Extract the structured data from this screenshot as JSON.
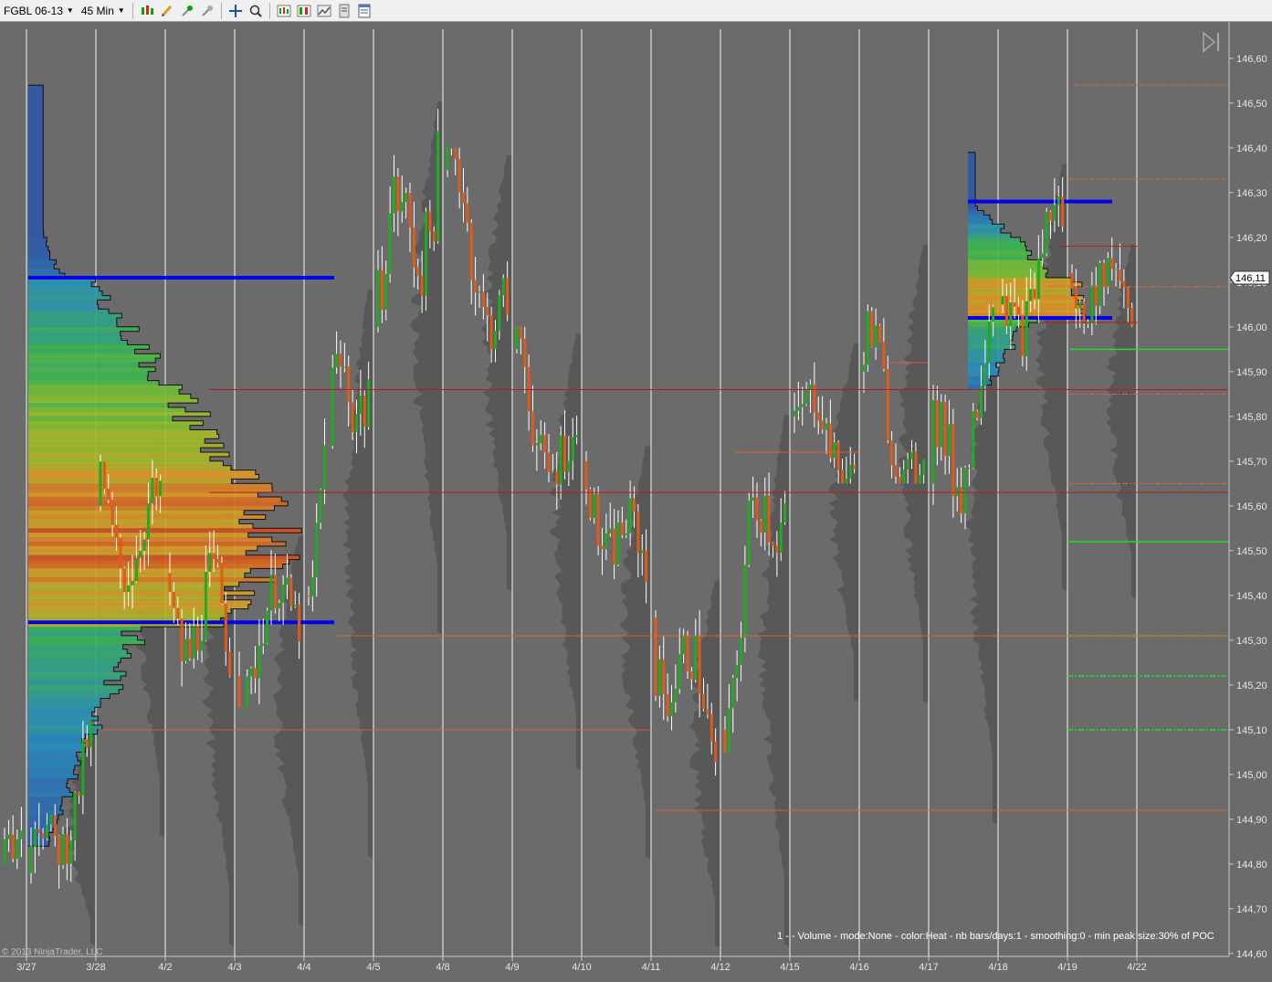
{
  "toolbar": {
    "instrument": "FGBL 06-13",
    "interval": "45 Min",
    "icons": [
      "bar-type-icon",
      "drawing-tools-icon",
      "pin-icon",
      "pin-global-icon",
      "crosshair-icon",
      "zoom-icon",
      "indicators-icon",
      "strategies-icon",
      "chart-properties-icon",
      "data-box-icon",
      "properties-icon"
    ]
  },
  "chart_data": {
    "type": "candlestick-volume-profile",
    "instrument": "FGBL 06-13",
    "interval": "45 Min",
    "ylim": [
      144.555,
      146.665
    ],
    "price_ticks": [
      "146,60",
      "146,50",
      "146,40",
      "146,30",
      "146,20",
      "146,10",
      "146,00",
      "145,90",
      "145,80",
      "145,70",
      "145,60",
      "145,50",
      "145,40",
      "145,30",
      "145,20",
      "145,10",
      "145,00",
      "144,90",
      "144,80",
      "144,70",
      "144,60"
    ],
    "price_values": [
      146.6,
      146.5,
      146.4,
      146.3,
      146.2,
      146.1,
      146.0,
      145.9,
      145.8,
      145.7,
      145.6,
      145.5,
      145.4,
      145.3,
      145.2,
      145.1,
      145.0,
      144.9,
      144.8,
      144.7,
      144.6
    ],
    "dates": [
      "3/27",
      "3/28",
      "4/2",
      "4/3",
      "4/4",
      "4/5",
      "4/8",
      "4/9",
      "4/10",
      "4/11",
      "4/12",
      "4/15",
      "4/16",
      "4/17",
      "4/18",
      "4/19",
      "4/22"
    ],
    "session_sides": [
      {
        "open": 144.78,
        "close": 145.04,
        "high": 145.12,
        "low": 144.7
      },
      {
        "open": 145.6,
        "close": 145.5,
        "high": 145.85,
        "low": 145.35
      },
      {
        "open": 145.45,
        "close": 145.25,
        "high": 145.7,
        "low": 145.1
      },
      {
        "open": 145.22,
        "close": 145.4,
        "high": 145.55,
        "low": 145.15
      },
      {
        "open": 145.4,
        "close": 146.05,
        "high": 146.1,
        "low": 145.3
      },
      {
        "open": 146.0,
        "close": 146.4,
        "high": 146.52,
        "low": 145.8
      },
      {
        "open": 146.35,
        "close": 146.0,
        "high": 146.4,
        "low": 145.9
      },
      {
        "open": 145.95,
        "close": 145.62,
        "high": 146.0,
        "low": 145.5
      },
      {
        "open": 145.7,
        "close": 145.4,
        "high": 145.75,
        "low": 145.3
      },
      {
        "open": 145.35,
        "close": 145.05,
        "high": 145.45,
        "low": 144.92
      },
      {
        "open": 145.1,
        "close": 145.75,
        "high": 145.82,
        "low": 145.05
      },
      {
        "open": 145.8,
        "close": 145.72,
        "high": 145.98,
        "low": 145.65
      },
      {
        "open": 145.9,
        "close": 145.7,
        "high": 146.2,
        "low": 145.65
      },
      {
        "open": 145.65,
        "close": 145.95,
        "high": 146.05,
        "low": 145.38
      },
      {
        "open": 146.05,
        "close": 146.18,
        "high": 146.38,
        "low": 145.9
      },
      {
        "open": 146.12,
        "close": 146.05,
        "high": 146.2,
        "low": 145.88
      },
      {
        "open": 146.05,
        "close": 146.11,
        "high": 146.13,
        "low": 146.02
      }
    ],
    "current_price": "146,11",
    "current_price_value": 146.11,
    "volume_profile_1": {
      "top": 146.54,
      "bottom": 144.84,
      "poc": 145.52,
      "value_area_high": 146.11,
      "value_area_low": 145.34
    },
    "volume_profile_2": {
      "top": 146.39,
      "bottom": 145.86,
      "poc": 146.05,
      "value_area_high": 146.28,
      "value_area_low": 146.02
    },
    "resistance_levels": [
      146.54,
      146.33,
      146.18,
      146.09,
      146.01,
      145.86,
      145.85,
      145.65,
      145.63
    ],
    "support_levels": [
      145.95,
      145.52,
      145.31,
      145.22,
      145.1
    ],
    "naked_levels": [
      145.31,
      145.1,
      144.92,
      145.72,
      145.92
    ],
    "info_text": "1 -   - Volume - mode:None - color:Heat - nb bars/days:1 - smoothing:0 - min peak size:30% of POC",
    "copyright": "© 2013 NinjaTrader, LLC"
  },
  "colors": {
    "background": "#6b6b6b",
    "session_line": "#c8c8c8",
    "up_candle": "#22aa22",
    "down_candle": "#e05a1a",
    "wick": "#ffffff",
    "resistance": "#e8603a",
    "support": "#22dd22",
    "value_area": "#0000ee",
    "profile_shadow": "#555555"
  }
}
